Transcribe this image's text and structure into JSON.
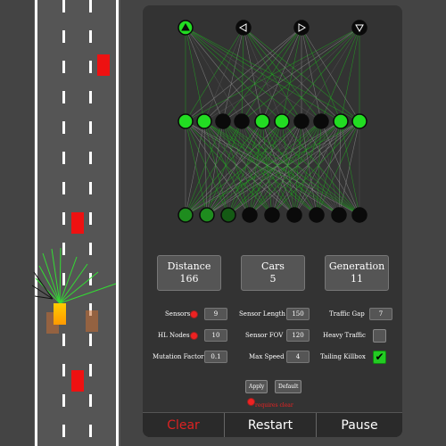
{
  "stats": {
    "distance": {
      "label": "Distance",
      "value": "166"
    },
    "cars": {
      "label": "Cars",
      "value": "5"
    },
    "generation": {
      "label": "Generation",
      "value": "11"
    }
  },
  "settings": {
    "sensors": {
      "label": "Sensors",
      "value": "9"
    },
    "sensor_length": {
      "label": "Sensor Length",
      "value": "150"
    },
    "traffic_gap": {
      "label": "Traffic Gap",
      "value": "7"
    },
    "hl_nodes": {
      "label": "HL Nodes",
      "value": "10"
    },
    "sensor_fov": {
      "label": "Sensor FOV",
      "value": "120"
    },
    "heavy_traffic": {
      "label": "Heavy Traffic",
      "checked": false
    },
    "mutation_factor": {
      "label": "Mutation Factor",
      "value": "0.1"
    },
    "max_speed": {
      "label": "Max Speed",
      "value": "4"
    },
    "tailing_killbox": {
      "label": "Tailing Killbox",
      "checked": true
    }
  },
  "buttons": {
    "apply": "Apply",
    "default": "Default",
    "clear": "Clear",
    "restart": "Restart",
    "pause": "Pause"
  },
  "requires_clear_note": "requires clear",
  "network": {
    "output_icons": [
      "arrow-up-icon",
      "arrow-left-icon",
      "arrow-right-icon",
      "arrow-down-icon"
    ],
    "output_active": [
      true,
      false,
      false,
      false
    ],
    "hidden_active": [
      true,
      true,
      false,
      false,
      true,
      true,
      false,
      false,
      true,
      true
    ],
    "input_levels": [
      1,
      1,
      0.5,
      0,
      0,
      0,
      0,
      0,
      0
    ]
  },
  "colors": {
    "accent_green": "#22dd22",
    "danger_red": "#ee2222",
    "clear_text": "#dd2222",
    "traffic_red": "#ee1111"
  }
}
